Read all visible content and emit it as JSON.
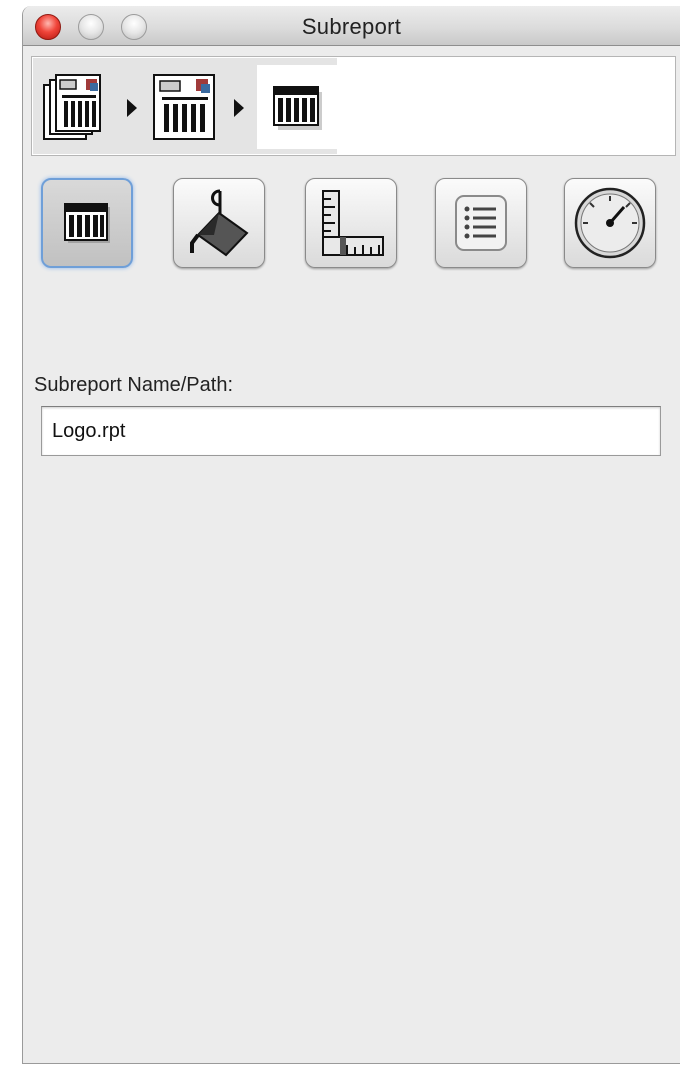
{
  "window": {
    "title": "Subreport"
  },
  "breadcrumb": {
    "items": [
      {
        "icon": "report-pages-stack-icon"
      },
      {
        "icon": "report-page-icon"
      },
      {
        "icon": "subreport-table-icon"
      }
    ]
  },
  "toolbar": {
    "buttons": [
      {
        "icon": "subreport-table-icon",
        "selected": true
      },
      {
        "icon": "paint-bucket-icon",
        "selected": false
      },
      {
        "icon": "ruler-icon",
        "selected": false
      },
      {
        "icon": "list-icon",
        "selected": false
      },
      {
        "icon": "gauge-icon",
        "selected": false
      }
    ]
  },
  "form": {
    "subreport_label": "Subreport Name/Path:",
    "subreport_value": "Logo.rpt"
  },
  "colors": {
    "selected_border": "#6f9fd8",
    "close_button": "#f0453a"
  }
}
